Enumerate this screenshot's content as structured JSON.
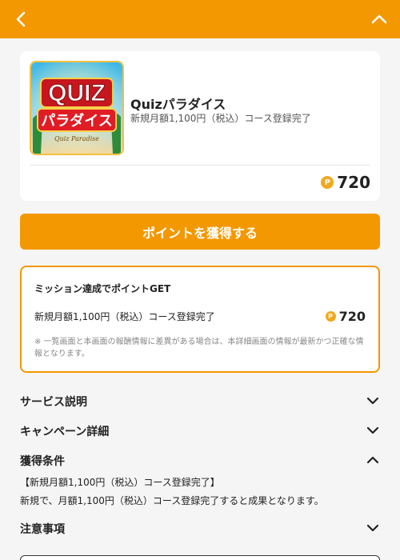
{
  "header": {
    "back_icon": "chevron-left-icon",
    "collapse_icon": "chevron-up-icon",
    "bg_color": "#f39800"
  },
  "product": {
    "thumbnail": {
      "logo_main": "QUIZ",
      "logo_sub": "パラダイス",
      "logo_tag": "Quiz Paradise"
    },
    "name": "Quizパラダイス",
    "course": "新規月額1,100円（税込）コース登録完了",
    "point_icon": "point-coin-icon",
    "point_symbol": "P",
    "points": "720"
  },
  "cta": {
    "label": "ポイントを獲得する"
  },
  "mission": {
    "title": "ミッション達成でポイントGET",
    "row_label": "新規月額1,100円（税込）コース登録完了",
    "point_symbol": "P",
    "points": "720",
    "note": "※ 一覧画面と本画面の報酬情報に差異がある場合は、本詳細画面の情報が最新かつ正確な情報となります。"
  },
  "sections": [
    {
      "label": "サービス説明",
      "state": "collapsed"
    },
    {
      "label": "キャンペーン詳細",
      "state": "collapsed"
    },
    {
      "label": "獲得条件",
      "state": "expanded"
    },
    {
      "label": "注意事項",
      "state": "collapsed"
    }
  ],
  "conditions": {
    "heading": "【新規月額1,100円（税込）コース登録完了】",
    "body": "新規で、月額1,100円（税込）コース登録完了すると成果となります。"
  },
  "colors": {
    "accent": "#f39800",
    "coin": "#f2a81d",
    "background": "#f5f5f5"
  }
}
